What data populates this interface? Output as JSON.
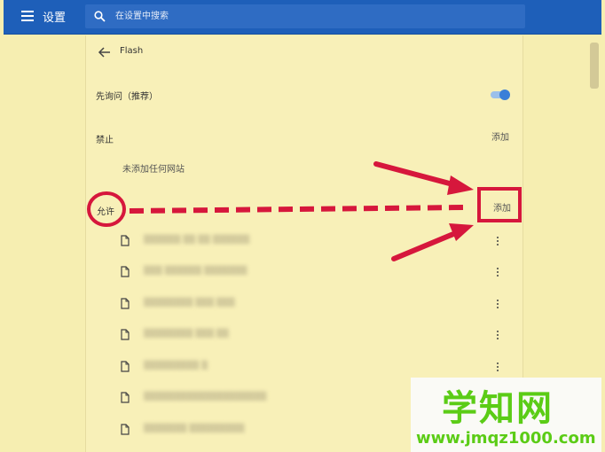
{
  "header": {
    "app_title": "设置",
    "search_placeholder": "在设置中搜索"
  },
  "page": {
    "title": "Flash",
    "ask_first_label": "先询问（推荐）",
    "ask_first_enabled": true
  },
  "block_section": {
    "label": "禁止",
    "add_label": "添加",
    "empty_text": "未添加任何网站"
  },
  "allow_section": {
    "label": "允许",
    "add_label": "添加",
    "sites": [
      {
        "url": "▒▒▒▒▒▒ ▒▒ ▒▒ ▒▒▒▒▒▒"
      },
      {
        "url": "▒▒▒ ▒▒▒▒▒▒ ▒▒▒▒▒▒▒"
      },
      {
        "url": "▒▒▒▒▒▒▒▒ ▒▒▒ ▒▒▒"
      },
      {
        "url": "▒▒▒▒▒▒▒▒ ▒▒▒ ▒▒"
      },
      {
        "url": "▒▒▒▒▒▒▒▒▒ ▒"
      },
      {
        "url": "▒▒▒▒▒▒▒▒▒▒▒▒▒▒▒▒▒▒▒▒"
      },
      {
        "url": "▒▒▒▒▒▒▒ ▒▒▒▒▒▒▒▒▒"
      }
    ]
  },
  "icons": {
    "menu": "hamburger-menu-icon",
    "search": "search-icon",
    "back": "arrow-left-icon",
    "site": "file-icon",
    "more": "more-vert-icon"
  },
  "colors": {
    "toolbar": "#1e5fb9",
    "page_bg": "#f6eeb1",
    "toggle_on": "#3a7fd8",
    "annotation": "#d6173c",
    "watermark": "#5bcc16"
  },
  "watermark": {
    "logo": "学知网",
    "url": "www.jmqz1000.com"
  }
}
